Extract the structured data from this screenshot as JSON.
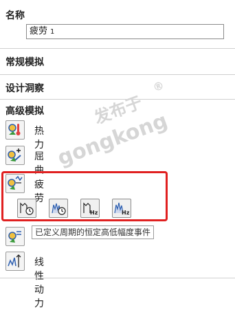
{
  "name_section": {
    "title": "名称",
    "value": "疲劳",
    "suffix": "1"
  },
  "sections": {
    "general": "常规模拟",
    "design": "设计洞察",
    "advanced": "高级模拟"
  },
  "tools": {
    "thermal": {
      "label": "热力",
      "icon": "thermal-icon"
    },
    "buckling": {
      "label": "屈曲",
      "icon": "buckling-icon"
    },
    "fatigue": {
      "label": "疲劳",
      "icon": "fatigue-icon"
    },
    "linear_dynamics": {
      "label": "线性动力",
      "icon": "linear-dynamics-icon"
    }
  },
  "fatigue_subtools": [
    "constant-amplitude-fatigue-icon",
    "variable-amplitude-fatigue-icon",
    "harmonic-fatigue-icon",
    "random-vibration-fatigue-icon"
  ],
  "tooltip": "已定义周期的恒定高低幅度事件",
  "watermark": {
    "line1": "发布于",
    "line2": "gongkong",
    "mark": "®"
  },
  "colors": {
    "highlight": "#e02020",
    "icon_blue": "#2a5db0",
    "icon_green": "#3a9a3a"
  }
}
